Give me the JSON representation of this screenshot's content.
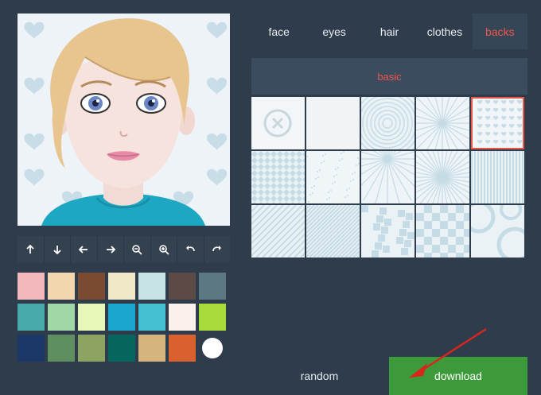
{
  "tabs": [
    {
      "label": "face",
      "active": false
    },
    {
      "label": "eyes",
      "active": false
    },
    {
      "label": "hair",
      "active": false
    },
    {
      "label": "clothes",
      "active": false
    },
    {
      "label": "backs",
      "active": true
    }
  ],
  "category": {
    "label": "basic"
  },
  "tools": [
    {
      "name": "move-up",
      "icon": "arrow-up-icon"
    },
    {
      "name": "move-down",
      "icon": "arrow-down-icon"
    },
    {
      "name": "move-left",
      "icon": "arrow-left-icon"
    },
    {
      "name": "move-right",
      "icon": "arrow-right-icon"
    },
    {
      "name": "zoom-out",
      "icon": "zoom-out-icon"
    },
    {
      "name": "zoom-in",
      "icon": "zoom-in-icon"
    },
    {
      "name": "undo",
      "icon": "undo-icon"
    },
    {
      "name": "redo",
      "icon": "redo-icon"
    }
  ],
  "palette": [
    "#f2b8bb",
    "#f2d6ad",
    "#7b4a33",
    "#efe7c6",
    "#c8e3e3",
    "#5b4a45",
    "#5c7880",
    "#46aaa8",
    "#9fd8a6",
    "#e6f7b8",
    "#1aa6cf",
    "#44c0d2",
    "#fbf1ec",
    "#a6db3a",
    "#1c3868",
    "#5f8f61",
    "#8ca362",
    "#06655e",
    "#d6b47e",
    "#d9612d",
    "#ffffff"
  ],
  "backgrounds": [
    {
      "pattern": "none",
      "selected": false
    },
    {
      "pattern": "plain",
      "selected": false
    },
    {
      "pattern": "circles",
      "selected": false
    },
    {
      "pattern": "rays",
      "selected": false
    },
    {
      "pattern": "hearts",
      "selected": true
    },
    {
      "pattern": "diamonds",
      "selected": false
    },
    {
      "pattern": "dots",
      "selected": false
    },
    {
      "pattern": "rays-soft",
      "selected": false
    },
    {
      "pattern": "burst",
      "selected": false
    },
    {
      "pattern": "stripes-vertical",
      "selected": false
    },
    {
      "pattern": "stripes-diagonal",
      "selected": false
    },
    {
      "pattern": "stripes-diagonal-fine",
      "selected": false
    },
    {
      "pattern": "pixels",
      "selected": false
    },
    {
      "pattern": "checker",
      "selected": false
    },
    {
      "pattern": "rings",
      "selected": false
    }
  ],
  "buttons": {
    "random": "random",
    "download": "download"
  },
  "colors": {
    "accent": "#f0554a",
    "download": "#3c9a3a",
    "annotation": "#d9261c"
  }
}
